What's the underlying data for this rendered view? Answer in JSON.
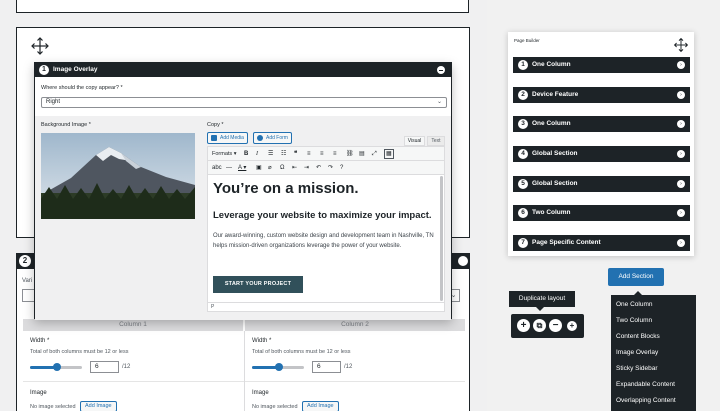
{
  "overlay": {
    "number": "1",
    "title": "Image Overlay",
    "question": "Where should the copy appear? *",
    "position_value": "Right",
    "bg_label": "Background Image *",
    "copy_label": "Copy *",
    "add_media": "Add Media",
    "add_form": "Add Form",
    "tab_visual": "Visual",
    "tab_text": "Text",
    "formats": "Formats",
    "headline": "You’re on a mission.",
    "subheadline": "Leverage your website to maximize your impact.",
    "paragraph": "Our award-winning, custom website design and development team in Nashville, TN helps mission-driven organizations leverage the power of your website.",
    "cta": "START YOUR PROJECT",
    "status": "P"
  },
  "two_column": {
    "number": "2",
    "variant_label": "Vari",
    "col1_head": "Column 1",
    "col2_head": "Column 2",
    "width_label": "Width *",
    "width_help": "Total of both columns must be 12 or less",
    "width_value": "6",
    "width_max": "/12",
    "width_fraction": 0.5,
    "image_label": "Image",
    "no_image": "No image selected",
    "add_image": "Add Image"
  },
  "page_builder": {
    "title": "Page Builder",
    "items": [
      {
        "num": "1",
        "label": "One Column"
      },
      {
        "num": "2",
        "label": "Device Feature"
      },
      {
        "num": "3",
        "label": "One Column"
      },
      {
        "num": "4",
        "label": "Global Section"
      },
      {
        "num": "5",
        "label": "Global Section"
      },
      {
        "num": "6",
        "label": "Two Column"
      },
      {
        "num": "7",
        "label": "Page Specific Content"
      }
    ]
  },
  "add_section": "Add Section",
  "add_menu": [
    "One Column",
    "Two Column",
    "Content Blocks",
    "Image Overlay",
    "Sticky Sidebar",
    "Expandable Content",
    "Overlapping Content"
  ],
  "tooltip": "Duplicate layout",
  "colors": {
    "dark": "#1d2327",
    "accent": "#2271b1",
    "cta": "#31505a"
  }
}
